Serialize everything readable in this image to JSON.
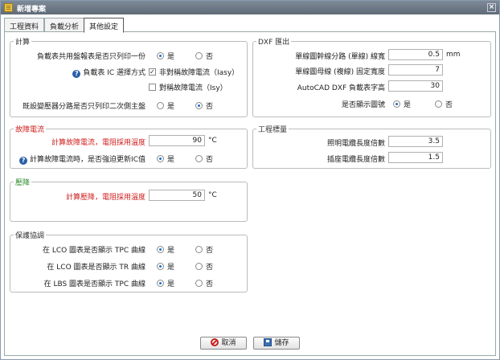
{
  "window": {
    "title": "新增專案",
    "close_glyph": "×"
  },
  "tabs": [
    {
      "label": "工程資料"
    },
    {
      "label": "負載分析"
    },
    {
      "label": "其他設定"
    }
  ],
  "calc": {
    "title": "計算",
    "q1_label": "負載表共用盤報表是否只列印一份",
    "q2_label": "負載表 IC 選擇方式",
    "q3_label": "既設變壓器分路是否只列印二次側主盤",
    "opt_yes": "是",
    "opt_no": "否",
    "cb1_label": "非對稱故障電流（Iasy）",
    "cb2_label": "對稱故障電流（Isy）"
  },
  "dxf": {
    "title": "DXF 匯出",
    "r1_label": "單線圖幹線分路 (單線) 線寬",
    "r1_value": "0.5",
    "r1_unit": "mm",
    "r2_label": "單線圖母線 (複線) 固定寬度",
    "r2_value": "7",
    "r3_label": "AutoCAD DXF 負載表字高",
    "r3_value": "30",
    "r4_label": "是否顯示圖號",
    "opt_yes": "是",
    "opt_no": "否"
  },
  "fault": {
    "title": "故障電流",
    "r1_label": "計算故障電流，電阻採用溫度",
    "r1_value": "90",
    "r1_unit": "°C",
    "r2_label": "計算故障電流時，是否強迫更新IC值",
    "opt_yes": "是",
    "opt_no": "否"
  },
  "quantity": {
    "title": "工程標量",
    "r1_label": "照明電纜長度倍數",
    "r1_value": "3.5",
    "r2_label": "插座電纜長度倍數",
    "r2_value": "1.5"
  },
  "vdrop": {
    "title": "壓降",
    "r1_label": "計算壓降，電阻採用溫度",
    "r1_value": "50",
    "r1_unit": "°C"
  },
  "protect": {
    "title": "保護協調",
    "r1_label": "在 LCO 圖表是否顯示 TPC 曲線",
    "r2_label": "在 LCO 圖表是否顯示 TR 曲線",
    "r3_label": "在 LBS 圖表是否顯示 TPC 曲線",
    "opt_yes": "是",
    "opt_no": "否"
  },
  "buttons": {
    "cancel": "取消",
    "save": "儲存"
  },
  "icons": {
    "info_glyph": "?"
  }
}
